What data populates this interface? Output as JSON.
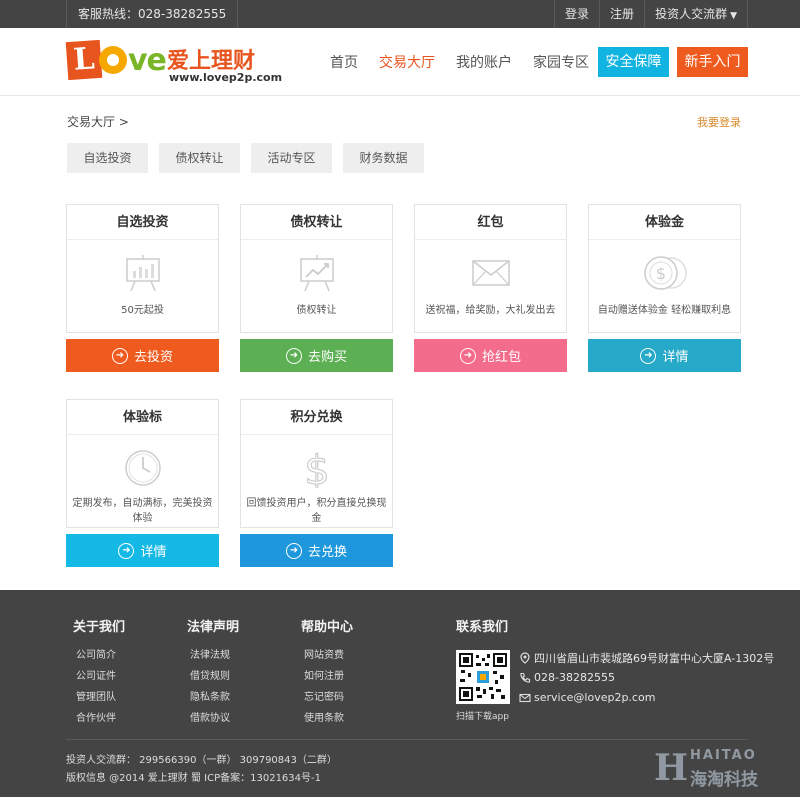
{
  "topbar": {
    "hotline": "客服热线：028-38282555",
    "login": "登录",
    "register": "注册",
    "investor_group": "投资人交流群"
  },
  "logo": {
    "brand_cn": "爱上理财",
    "url": "www.lovep2p.com"
  },
  "nav": {
    "items": [
      "首页",
      "交易大厅",
      "我的账户",
      "家园专区"
    ],
    "active": "交易大厅",
    "safety": "安全保障",
    "newbie": "新手入门"
  },
  "breadcrumb": "交易大厅 >",
  "login_link": "我要登录",
  "tabs": [
    "自选投资",
    "债权转让",
    "活动专区",
    "财务数据"
  ],
  "cards": [
    {
      "title": "自选投资",
      "desc": "50元起投",
      "button": "去投资",
      "icon": "chart-board-icon",
      "color": "#ef5b1e"
    },
    {
      "title": "债权转让",
      "desc": "债权转让",
      "button": "去购买",
      "icon": "trend-board-icon",
      "color": "#5caf52"
    },
    {
      "title": "红包",
      "desc": "送祝福，给奖励，大礼发出去",
      "button": "抢红包",
      "icon": "envelope-icon",
      "color": "#f36c8b"
    },
    {
      "title": "体验金",
      "desc": "自动赠送体验金 轻松赚取利息",
      "button": "详情",
      "icon": "coins-icon",
      "color": "#27a9c9"
    },
    {
      "title": "体验标",
      "desc": "定期发布，自动满标，完美投资体验",
      "button": "详情",
      "icon": "clock-icon",
      "color": "#14b9e6"
    },
    {
      "title": "积分兑换",
      "desc": "回馈投资用户，积分直接兑换现金",
      "button": "去兑换",
      "icon": "dollar-icon",
      "color": "#1e97dc"
    }
  ],
  "footer": {
    "about": {
      "title": "关于我们",
      "items": [
        "公司简介",
        "公司证件",
        "管理团队",
        "合作伙伴"
      ]
    },
    "legal": {
      "title": "法律声明",
      "items": [
        "法律法规",
        "借贷规则",
        "隐私条款",
        "借款协议"
      ]
    },
    "help": {
      "title": "帮助中心",
      "items": [
        "网站资费",
        "如何注册",
        "忘记密码",
        "使用条款"
      ]
    },
    "contact": {
      "title": "联系我们",
      "address": "四川省眉山市裴城路69号财富中心大厦A-1302号",
      "phone": "028-38282555",
      "email": "service@lovep2p.com",
      "qr_caption": "扫描下载app"
    },
    "groups": "投资人交流群：  299566390（一群）    309790843（二群）",
    "copyright": "版权信息  @2014 爱上理财    蜀 ICP备案：13021634号-1"
  },
  "watermark": {
    "latin": "HAITAO",
    "cn": "海淘科技",
    "initial": "H"
  }
}
